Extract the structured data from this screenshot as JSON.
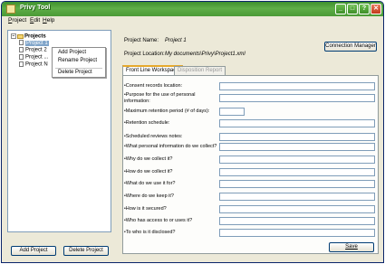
{
  "window": {
    "title": "Privy Tool",
    "minimize": "_",
    "maximize": "□",
    "help": "?",
    "close": "✕"
  },
  "menu": [
    {
      "key": "P",
      "rest": "roject"
    },
    {
      "key": "E",
      "rest": "dit"
    },
    {
      "key": "H",
      "rest": "elp"
    }
  ],
  "tree": {
    "root": "Projects",
    "expander": "−",
    "items": [
      "Project 1",
      "Project 2",
      "Project ...",
      "Project N"
    ]
  },
  "context_menu": {
    "items": [
      "Add Project",
      "Rename Project",
      "Delete Project"
    ]
  },
  "buttons": {
    "add_project": "Add Project",
    "delete_project": "Delete Project",
    "connection_manager": "Connection Manager",
    "save": "Save"
  },
  "project": {
    "name_label": "Project Name:",
    "name_value": "Project 1",
    "location_label": "Project Location:",
    "location_value": "My documents\\Privy\\Project1.xml"
  },
  "tabs": [
    "Front Line Workspace",
    "Disposition Report"
  ],
  "fields": [
    "Consent records location:",
    "Purpose for the use of personal information:",
    "Maximum retention period (# of days):",
    "Retention schedule:",
    "Scheduled reviews notes:",
    "What personal information do we collect?",
    "Why do we collect it?",
    "How do we collect it?",
    "What do we use it for?",
    "Where do we keep it?",
    "How is it secured?",
    "Who has access to or uses it?",
    "To who is it disclosed?"
  ]
}
